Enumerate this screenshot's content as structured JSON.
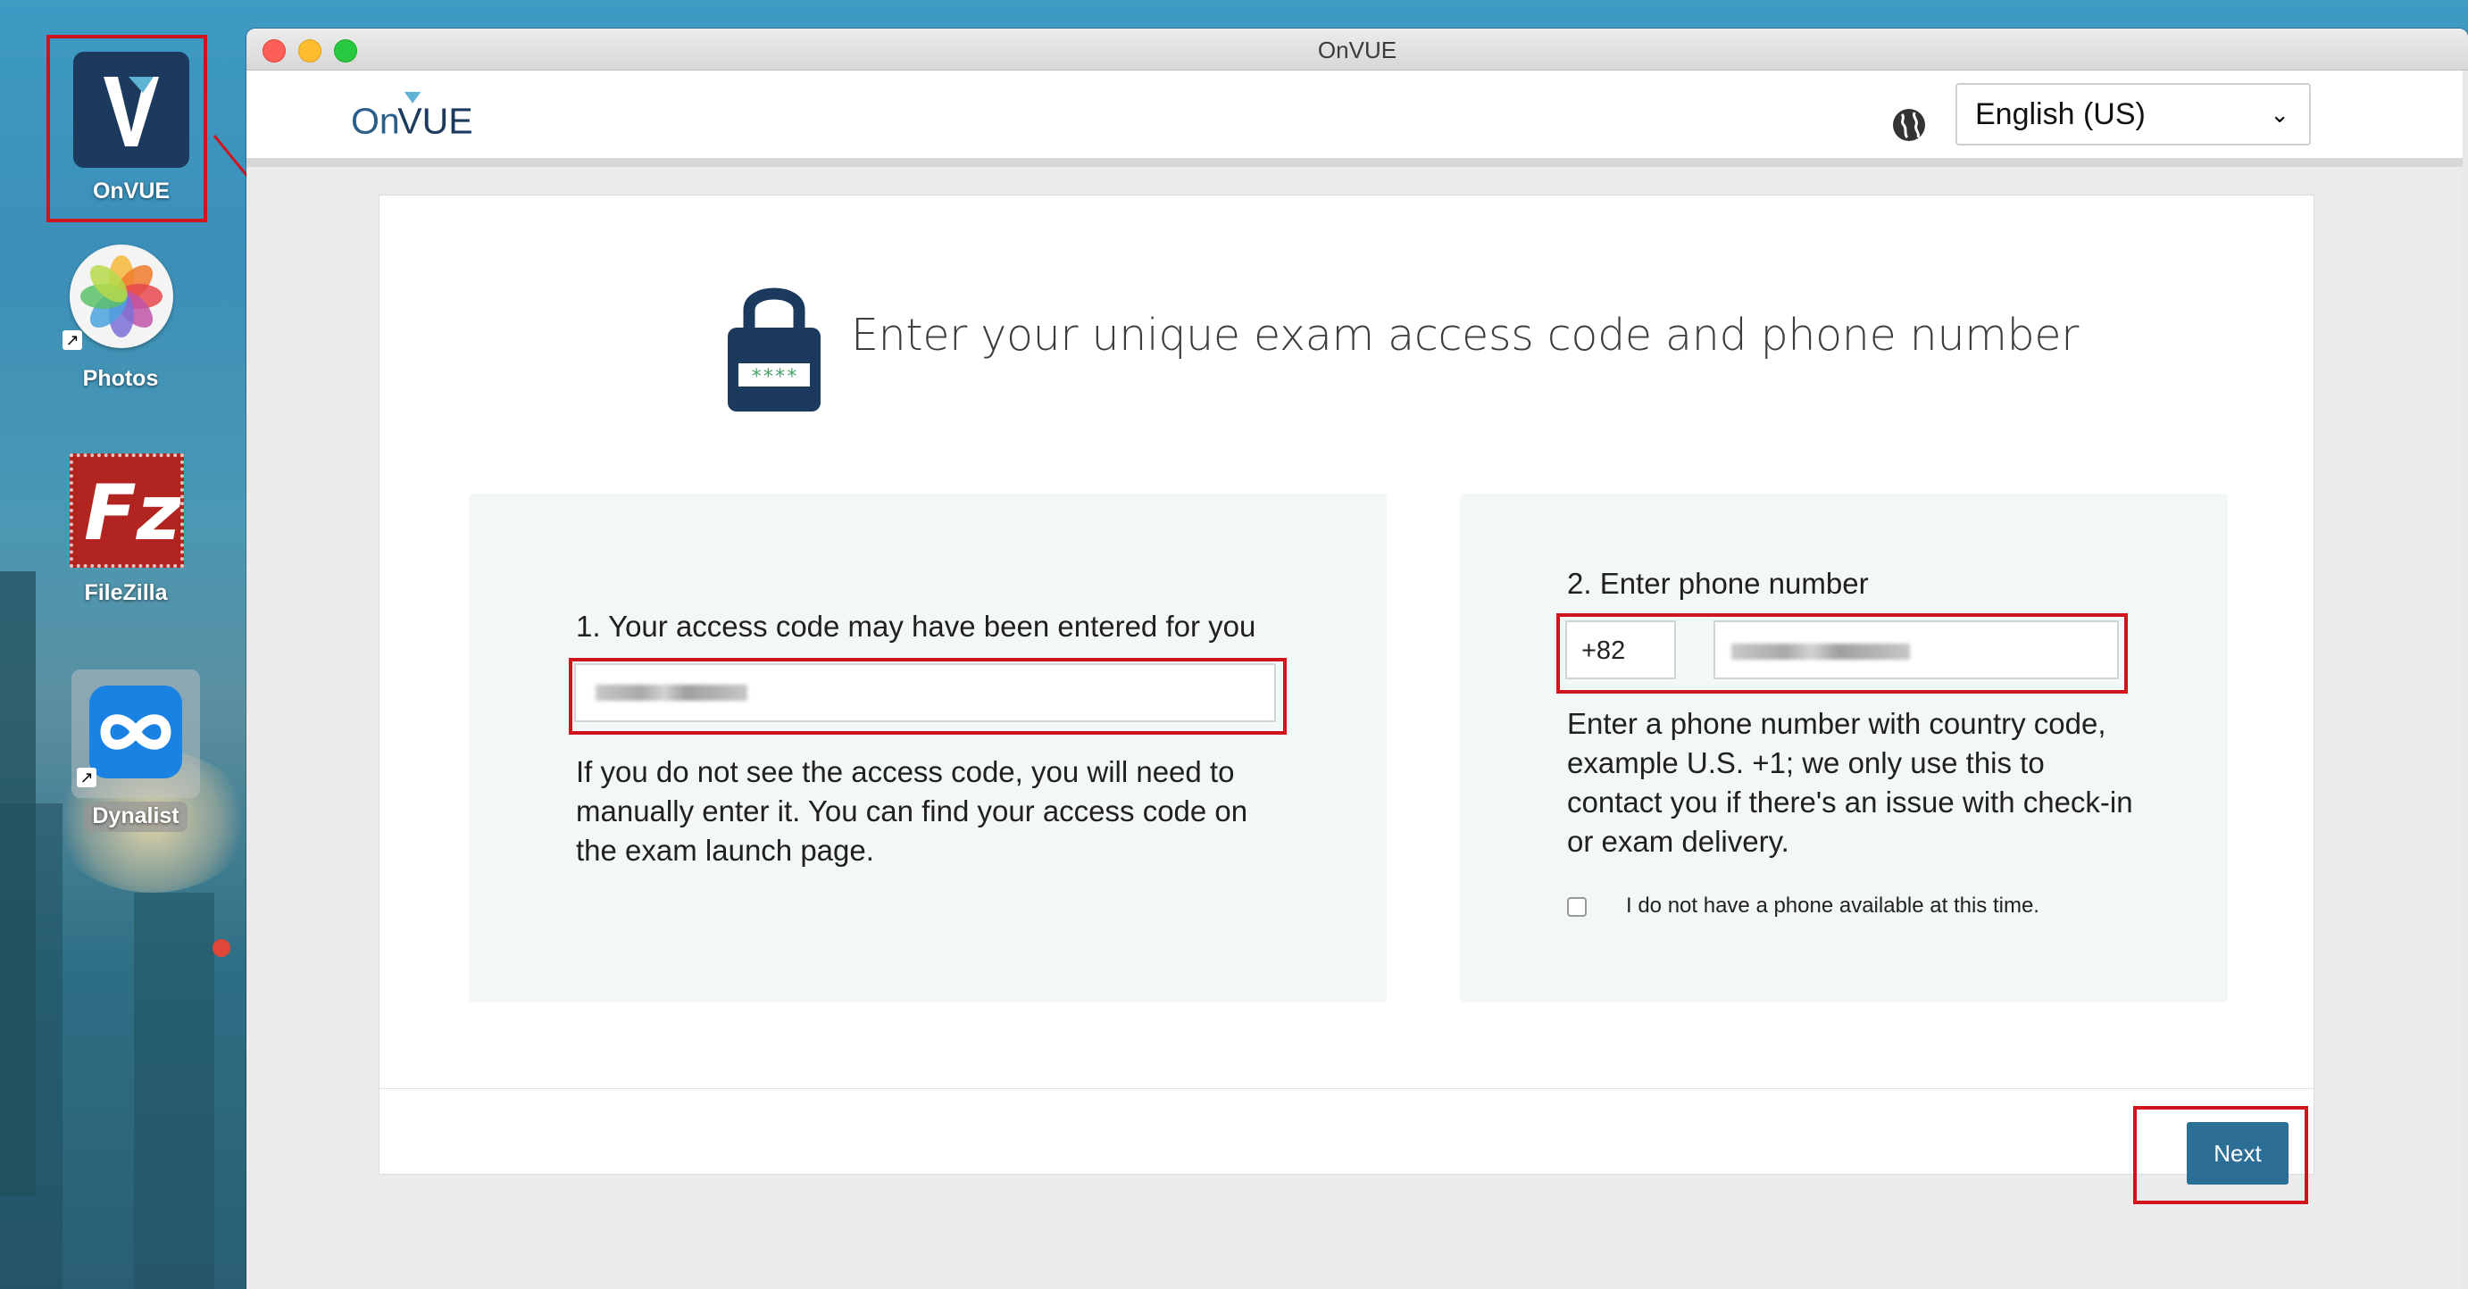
{
  "desktop": {
    "icons": [
      {
        "label": "OnVUE"
      },
      {
        "label": "Photos"
      },
      {
        "label": "FileZilla"
      },
      {
        "label": "Dynalist"
      }
    ]
  },
  "window": {
    "title": "OnVUE"
  },
  "app": {
    "logo_text_on": "On",
    "logo_text_vue": "VUE",
    "language": {
      "selected": "English (US)"
    }
  },
  "main": {
    "heading": "Enter your unique exam access code and phone number",
    "lock_code_glyph": "****",
    "access_panel": {
      "label": "1. Your access code may have been entered for you",
      "help": "If you do not see the access code, you will need to manually enter it. You can find your access code on the exam launch page."
    },
    "phone_panel": {
      "label": "2. Enter phone number",
      "country_code": "+82",
      "help": "Enter a phone number with country code, example U.S. +1; we only use this to contact you if there's an issue with check-in or exam delivery.",
      "no_phone_label": "I do not have a phone available at this time."
    },
    "next_label": "Next"
  },
  "colors": {
    "accent": "#2d6e96",
    "annotation_red": "#d0141e",
    "panel_bg": "#f3f7f6",
    "brand_navy": "#1b3a5e"
  }
}
